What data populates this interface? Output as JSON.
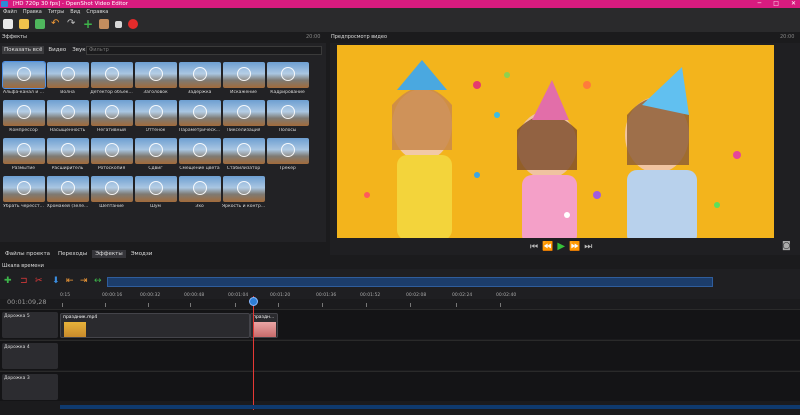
{
  "window": {
    "title": "[HD 720p 30 fps] - OpenShot Video Editor",
    "controls": [
      "─",
      "□",
      "✕"
    ]
  },
  "menu": [
    "Файл",
    "Правка",
    "Титры",
    "Вид",
    "Справка"
  ],
  "toolbar": {
    "icons": [
      "new-file-icon",
      "open-folder-icon",
      "save-icon",
      "undo-icon",
      "redo-icon",
      "add-icon",
      "export-icon",
      "fullscreen-icon",
      "record-icon"
    ],
    "colors": [
      "#e9e9e9",
      "#f0c24c",
      "#4fb65d",
      "#f29a37",
      "#bdbdbd",
      "#3db54a",
      "#c38d5e",
      "#d8d8d8",
      "#e32b2b"
    ]
  },
  "effects_panel": {
    "title": "Эффекты",
    "time": "20:00",
    "tabs": [
      "Показать всё",
      "Видео",
      "Звук"
    ],
    "filter_placeholder": "Фильтр",
    "items": [
      "Альфа-канал и ...",
      "Волна",
      "Детектор объек...",
      "Заголовок",
      "Задержка",
      "Искажение",
      "Кадрирование",
      "Компрессор",
      "Насыщенность",
      "Негативный",
      "Оттенок",
      "Параметрическ...",
      "Пикселизация",
      "Полосы",
      "Размытие",
      "Расширитель",
      "Ротоскопия",
      "Сдвиг",
      "Смещение цвета",
      "Стабилизатор",
      "Трекер",
      "Убрать чересст...",
      "Хромакей (зеле...",
      "Шептание",
      "Шум",
      "Эхо",
      "Яркость и контр..."
    ]
  },
  "preview_panel": {
    "title": "Предпросмотр видео",
    "time": "20:00"
  },
  "lower_tabs": [
    "Файлы проекта",
    "Переходы",
    "Эффекты",
    "Эмодзи"
  ],
  "timeline": {
    "label": "Шкала времени",
    "timecode": "00:01:09,28",
    "ruler": [
      "0:15",
      "00:00:16",
      "00:00:32",
      "00:00:48",
      "00:01:04",
      "00:01:20",
      "00:01:36",
      "00:01:52",
      "00:02:08",
      "00:02:24",
      "00:02:40"
    ],
    "tracks": [
      {
        "name": "Дорожка 5",
        "clips": [
          {
            "name": "праздник.mp4"
          },
          {
            "name": "праздн..."
          }
        ]
      },
      {
        "name": "Дорожка 4",
        "clips": []
      },
      {
        "name": "Дорожка 3",
        "clips": []
      }
    ]
  }
}
